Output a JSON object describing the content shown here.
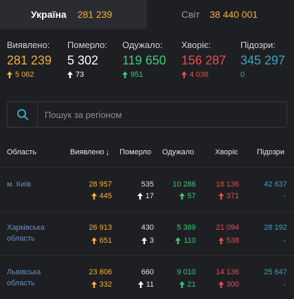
{
  "tabs": [
    {
      "name": "Україна",
      "count": "281 239"
    },
    {
      "name": "Світ",
      "count": "38 440 001"
    }
  ],
  "stats": [
    {
      "label": "Виявлено:",
      "value": "281 239",
      "delta": "5 062",
      "color": "#f2b233",
      "arrow": "up-orange"
    },
    {
      "label": "Померло:",
      "value": "5 302",
      "delta": "73",
      "color": "#ffffff",
      "arrow": "up-white"
    },
    {
      "label": "Одужало:",
      "value": "119 650",
      "delta": "951",
      "color": "#3ec97a",
      "arrow": "up-green"
    },
    {
      "label": "Хворіє:",
      "value": "156 287",
      "delta": "4 038",
      "color": "#ea4d4d",
      "arrow": "up-red"
    },
    {
      "label": "Підозри:",
      "value": "345 297",
      "delta": "0",
      "color": "#3aa5c4",
      "arrow": "none"
    }
  ],
  "search": {
    "placeholder": "Пошук за регіоном"
  },
  "table": {
    "headers": [
      "Область",
      "Виявлено",
      "Померло",
      "Одужало",
      "Хворіє",
      "Підозри"
    ],
    "sort_indicator": "↓",
    "rows": [
      {
        "region": [
          "м. Київ"
        ],
        "detected": "28 957",
        "detected_delta": "445",
        "died": "535",
        "died_delta": "17",
        "recovered": "10 286",
        "recovered_delta": "57",
        "sick": "18 136",
        "sick_delta": "371",
        "suspect": "42 637",
        "suspect_delta": "-"
      },
      {
        "region": [
          "Харківська",
          "область"
        ],
        "detected": "26 913",
        "detected_delta": "651",
        "died": "430",
        "died_delta": "3",
        "recovered": "5 389",
        "recovered_delta": "110",
        "sick": "21 094",
        "sick_delta": "538",
        "suspect": "28 192",
        "suspect_delta": "-"
      },
      {
        "region": [
          "Львівська",
          "область"
        ],
        "detected": "23 806",
        "detected_delta": "332",
        "died": "660",
        "died_delta": "11",
        "recovered": "9 010",
        "recovered_delta": "21",
        "sick": "14 136",
        "sick_delta": "300",
        "suspect": "25 647",
        "suspect_delta": "-"
      }
    ]
  },
  "colors": {
    "background": "#1e1f23",
    "active_tab": "#2b2c31",
    "accent_orange": "#f2b233",
    "green": "#3ec97a",
    "red": "#ea4d4d",
    "teal": "#3aa5c4",
    "region_link": "#6e8fc4"
  }
}
